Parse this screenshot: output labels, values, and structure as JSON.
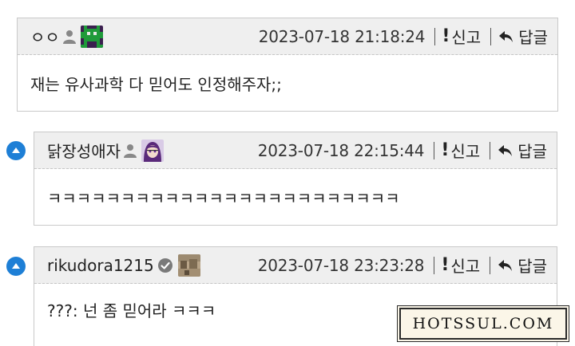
{
  "comments": [
    {
      "nickname": "ㅇㅇ",
      "timestamp": "2023-07-18 21:18:24",
      "report_label": "신고",
      "reply_label": "답글",
      "body": "재는 유사과학 다 믿어도 인정해주자;;",
      "icon": "user-icon",
      "avatar": "pixel-alien-avatar"
    },
    {
      "nickname": "닭장성애자",
      "timestamp": "2023-07-18 22:15:44",
      "report_label": "신고",
      "reply_label": "답글",
      "body": "ㅋㅋㅋㅋㅋㅋㅋㅋㅋㅋㅋㅋㅋㅋㅋㅋㅋㅋㅋㅋㅋㅋㅋㅋ",
      "icon": "user-icon",
      "avatar": "anime-girl-avatar"
    },
    {
      "nickname": "rikudora1215",
      "timestamp": "2023-07-18 23:23:28",
      "report_label": "신고",
      "reply_label": "답글",
      "body": "???: 넌 좀 믿어라 ㅋㅋㅋ",
      "icon": "verified-check-icon",
      "avatar": "photo-avatar"
    }
  ],
  "watermark": "HOTSSUL.COM",
  "colors": {
    "header_bg": "#efefef",
    "border": "#c9c9c9",
    "reply_marker": "#1e7fd6"
  }
}
